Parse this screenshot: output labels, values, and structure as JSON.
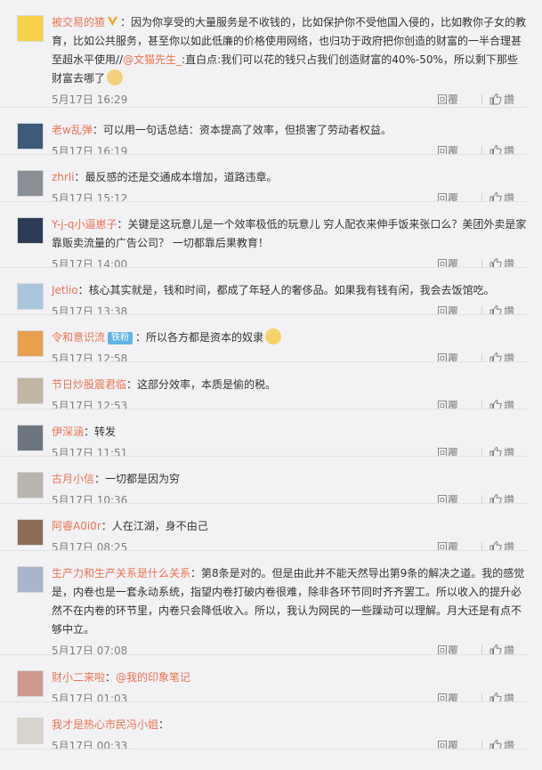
{
  "comments": [
    {
      "user": "被交易的猹",
      "parts": [
        {
          "t": "：因为你享受的大量服务是不收钱的，比如保护你不受他国入侵的，比如教你子女的教育，比如公共服务，甚至你以如此低廉的价格使用网络，也归功于政府把你创造的财富的一半合理甚至超水平使用//"
        },
        {
          "m": "@文猫先生_"
        },
        {
          "t": ":直白点:我们可以花的钱只占我们创造财富的40%-50%，所以剩下那些财富去哪了"
        }
      ],
      "time": "5月17日 16:29"
    },
    {
      "user": "老w乱弹",
      "parts": [
        {
          "t": "：可以用一句话总结：资本提高了效率，但损害了劳动者权益。"
        }
      ],
      "time": "5月17日 16:19"
    },
    {
      "user": "zhrli",
      "parts": [
        {
          "t": "：最反感的还是交通成本增加，道路违章。"
        }
      ],
      "time": "5月17日 15:12"
    },
    {
      "user": "Y-j-q小逼崽子",
      "parts": [
        {
          "t": "：关键是这玩意儿是一个效率极低的玩意儿 穷人配衣来伸手饭来张口么？美团外卖是家靠贩卖流量的广告公司？ 一切都靠后果教育！"
        }
      ],
      "time": "5月17日 14:00"
    },
    {
      "user": "Jetlio",
      "parts": [
        {
          "t": "：核心其实就是，钱和时间，都成了年轻人的奢侈品。如果我有钱有闲，我会去饭馆吃。"
        }
      ],
      "time": "5月17日 13:38"
    },
    {
      "user": "令和意识流",
      "tag": "铁粉",
      "parts": [
        {
          "t": "：所以各方都是资本的奴隶"
        }
      ],
      "time": "5月17日 12:58"
    },
    {
      "user": "节日炒股震君临",
      "parts": [
        {
          "t": "：这部分效率，本质是偷的税。"
        }
      ],
      "time": "5月17日 12:53"
    },
    {
      "user": "伊深涵",
      "parts": [
        {
          "t": "：转发"
        }
      ],
      "time": "5月17日 11:51"
    },
    {
      "user": "古月小信",
      "parts": [
        {
          "t": "：一切都是因为穷"
        }
      ],
      "time": "5月17日 10:36"
    },
    {
      "user": "阿睿A0i0r",
      "parts": [
        {
          "t": "：人在江湖，身不由己"
        }
      ],
      "time": "5月17日 08:25"
    },
    {
      "user": "生产力和生产关系是什么关系",
      "parts": [
        {
          "t": "：第8条是对的。但是由此并不能天然导出第9条的解决之道。我的感觉是，内卷也是一套永动系统，指望内卷打破内卷很难，除非各环节同时齐齐罢工。所以收入的提升必然不在内卷的环节里，内卷只会降低收入。所以，我认为网民的一些躁动可以理解。月大还是有点不够中立。"
        }
      ],
      "time": "5月17日 07:08"
    },
    {
      "user": "财小二来啦",
      "parts": [
        {
          "t": "："
        },
        {
          "m": "@我的印象笔记"
        }
      ],
      "time": "5月17日 01:03"
    },
    {
      "user": "我才是热心市民冯小姐",
      "parts": [
        {
          "t": "：​"
        }
      ],
      "time": "5月17日 00:33"
    }
  ],
  "actions": {
    "reply": "回覆",
    "like": "讚"
  },
  "avatar_colors": [
    "#f5d24a",
    "#3c5b7a",
    "#8a8f96",
    "#2d3b55",
    "#a9c6dd",
    "#e8a04f",
    "#c2b6a4",
    "#6d7580",
    "#b9b4ac",
    "#8c6d55",
    "#a9b6c9",
    "#cf9a8e",
    "#d8d4cc"
  ],
  "colors": {
    "username": "#eb7350",
    "background": "#f2f2f5",
    "meta": "#808080"
  }
}
